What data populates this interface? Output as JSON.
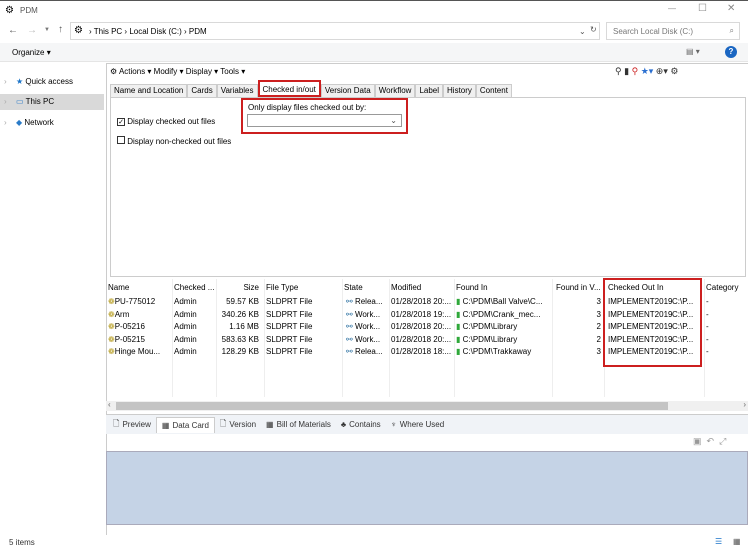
{
  "window": {
    "title": "PDM"
  },
  "address": {
    "crumbs": [
      "This PC",
      "Local Disk (C:)",
      "PDM"
    ],
    "search_placeholder": "Search Local Disk (C:)"
  },
  "organize": {
    "label": "Organize"
  },
  "nav": {
    "items": [
      {
        "label": "Quick access"
      },
      {
        "label": "This PC"
      },
      {
        "label": "Network"
      }
    ]
  },
  "pdm_toolbar": {
    "menus": [
      "Actions",
      "Modify",
      "Display",
      "Tools"
    ]
  },
  "tabs": [
    "Name and Location",
    "Cards",
    "Variables",
    "Checked in/out",
    "Version Data",
    "Workflow",
    "Label",
    "History",
    "Content"
  ],
  "active_tab": "Checked in/out",
  "checkin": {
    "display_checked_out": {
      "label": "Display checked out files",
      "checked": true
    },
    "display_non_checked_out": {
      "label": "Display non-checked out files",
      "checked": false
    },
    "only_by_label": "Only display files checked out by:",
    "only_by_value": ""
  },
  "columns": [
    "Name",
    "Checked ...",
    "Size",
    "File Type",
    "State",
    "Modified",
    "Found In",
    "Found in V...",
    "Checked Out In",
    "Category"
  ],
  "rows": [
    {
      "name": "PU-775012",
      "checked": "Admin",
      "size": "59.57 KB",
      "type": "SLDPRT File",
      "state": "Relea...",
      "modified": "01/28/2018 20:...",
      "found_in": "C:\\PDM\\Ball Valve\\C...",
      "version": "3",
      "out_in": "IMPLEMENT2019",
      "out_path": "C:\\P...",
      "category": "-"
    },
    {
      "name": "Arm",
      "checked": "Admin",
      "size": "340.26 KB",
      "type": "SLDPRT File",
      "state": "Work...",
      "modified": "01/28/2018 19:...",
      "found_in": "C:\\PDM\\Crank_mec...",
      "version": "3",
      "out_in": "IMPLEMENT2019",
      "out_path": "C:\\P...",
      "category": "-"
    },
    {
      "name": "P-05216",
      "checked": "Admin",
      "size": "1.16 MB",
      "type": "SLDPRT File",
      "state": "Work...",
      "modified": "01/28/2018 20:...",
      "found_in": "C:\\PDM\\Library",
      "version": "2",
      "out_in": "IMPLEMENT2019",
      "out_path": "C:\\P...",
      "category": "-"
    },
    {
      "name": "P-05215",
      "checked": "Admin",
      "size": "583.63 KB",
      "type": "SLDPRT File",
      "state": "Work...",
      "modified": "01/28/2018 20:...",
      "found_in": "C:\\PDM\\Library",
      "version": "2",
      "out_in": "IMPLEMENT2019",
      "out_path": "C:\\P...",
      "category": "-"
    },
    {
      "name": "Hinge Mou...",
      "checked": "Admin",
      "size": "128.29 KB",
      "type": "SLDPRT File",
      "state": "Relea...",
      "modified": "01/28/2018 18:...",
      "found_in": "C:\\PDM\\Trakkaway",
      "version": "3",
      "out_in": "IMPLEMENT2019",
      "out_path": "C:\\P...",
      "category": "-"
    }
  ],
  "bottom_tabs": [
    "Preview",
    "Data Card",
    "Version",
    "Bill of Materials",
    "Contains",
    "Where Used"
  ],
  "status": {
    "items": "5 items"
  },
  "colors": {
    "highlight": "#cc1f1f",
    "datacard": "#c5d3e6"
  }
}
